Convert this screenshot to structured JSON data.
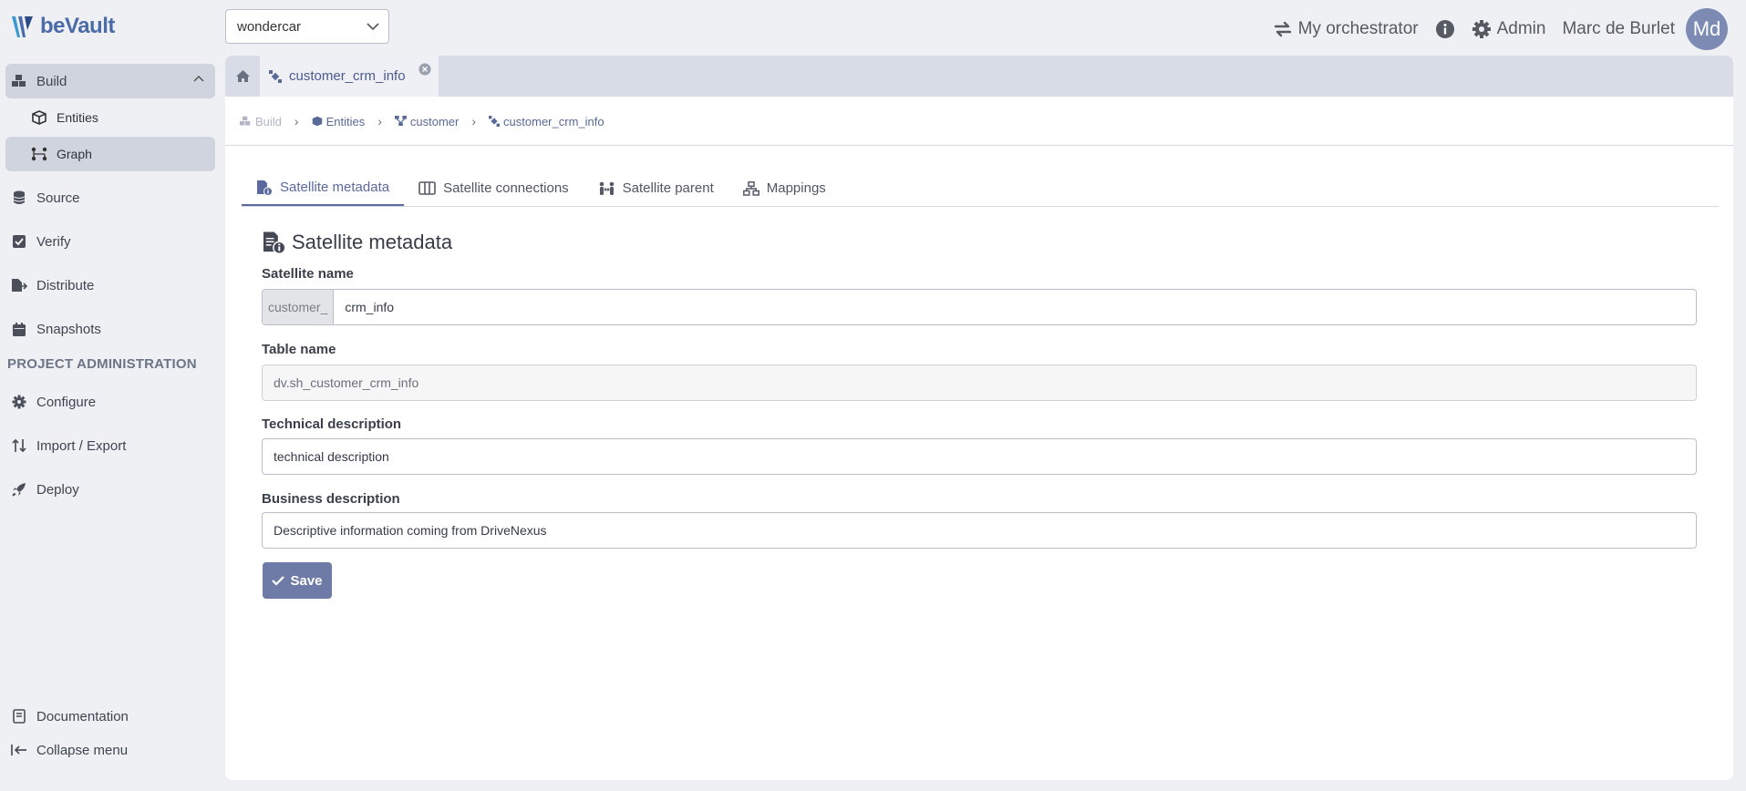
{
  "app": {
    "logo_text": "beVault"
  },
  "header": {
    "project": "wondercar",
    "orchestrator_label": "My orchestrator",
    "admin_label": "Admin",
    "user_name": "Marc de Burlet",
    "user_initials": "Md"
  },
  "sidebar": {
    "build_label": "Build",
    "entities_label": "Entities",
    "graph_label": "Graph",
    "source_label": "Source",
    "verify_label": "Verify",
    "distribute_label": "Distribute",
    "snapshots_label": "Snapshots",
    "admin_section": "PROJECT ADMINISTRATION",
    "configure_label": "Configure",
    "import_export_label": "Import / Export",
    "deploy_label": "Deploy",
    "documentation_label": "Documentation",
    "collapse_label": "Collapse menu"
  },
  "doc_tab": {
    "label": "customer_crm_info"
  },
  "breadcrumb": {
    "build": "Build",
    "entities": "Entities",
    "customer": "customer",
    "current": "customer_crm_info"
  },
  "tabs": {
    "metadata": "Satellite metadata",
    "connections": "Satellite connections",
    "parent": "Satellite parent",
    "mappings": "Mappings"
  },
  "form": {
    "title": "Satellite metadata",
    "satellite_name_label": "Satellite name",
    "satellite_name_prefix": "customer_",
    "satellite_name_value": "crm_info",
    "table_name_label": "Table name",
    "table_name_value": "dv.sh_customer_crm_info",
    "technical_description_label": "Technical description",
    "technical_description_value": "technical description",
    "business_description_label": "Business description",
    "business_description_value": "Descriptive information coming from DriveNexus",
    "save_label": "Save"
  },
  "colors": {
    "accent": "#6e7ba6",
    "sidebar_active": "#d0d4de",
    "background": "#eef0f4"
  }
}
